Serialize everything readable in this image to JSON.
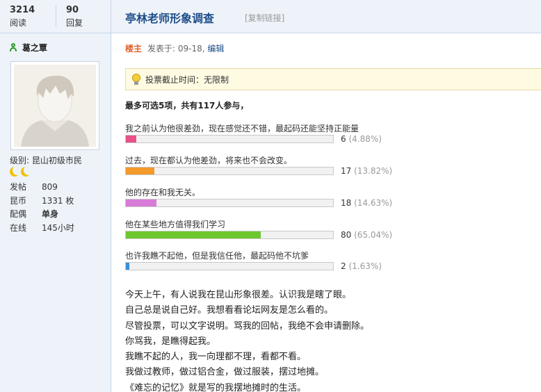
{
  "stats": {
    "reads_value": "3214",
    "reads_label": "阅读",
    "replies_value": "90",
    "replies_label": "回复"
  },
  "thread": {
    "title": "亭林老师形象调查",
    "copy_link": "[复制链接]"
  },
  "user": {
    "name": "葛之覃",
    "level": "级别: 昆山初级市民",
    "profile": [
      {
        "key": "发帖",
        "value": "809",
        "bold": false
      },
      {
        "key": "昆币",
        "value": "1331 枚",
        "bold": false
      },
      {
        "key": "配偶",
        "value": "单身",
        "bold": true
      },
      {
        "key": "在线",
        "value": "145小时",
        "bold": false
      }
    ]
  },
  "post": {
    "owner_label": "楼主",
    "posted": "发表于: 09-18",
    "separator": ",",
    "edit_label": "编辑"
  },
  "poll": {
    "deadline": "投票截止时间：无限制",
    "note": "最多可选5项，共有117人参与，",
    "options": [
      {
        "label": "我之前认为他很差劲，现在感觉还不错，最起码还能坚持正能量",
        "count": "6",
        "pct": "(4.88%)",
        "fraction": 0.0488,
        "color": "#e8508a"
      },
      {
        "label": "过去，现在都认为他差劲，将来也不会改变。",
        "count": "17",
        "pct": "(13.82%)",
        "fraction": 0.1382,
        "color": "#f39a2b"
      },
      {
        "label": "他的存在和我无关。",
        "count": "18",
        "pct": "(14.63%)",
        "fraction": 0.1463,
        "color": "#d87ad8"
      },
      {
        "label": "他在某些地方值得我们学习",
        "count": "80",
        "pct": "(65.04%)",
        "fraction": 0.6504,
        "color": "#6dc72f"
      },
      {
        "label": "也许我瞧不起他，但是我信任他，最起码他不坑爹",
        "count": "2",
        "pct": "(1.63%)",
        "fraction": 0.0163,
        "color": "#3a8fd6"
      }
    ]
  },
  "content": {
    "lines": [
      "今天上午，有人说我在昆山形象很差。认识我是瞎了眼。",
      "自己总是说自己好。我想看看论坛网友是怎么看的。",
      "尽管投票，可以文字说明。骂我的回帖，我绝不会申请删除。",
      "你骂我，是瞧得起我。",
      "我瞧不起的人，我一向理都不理，看都不看。",
      "我做过教师，做过铝合金，做过服装，摆过地摊。",
      "《难忘的记忆》就是写的我摆地摊时的生活。"
    ]
  },
  "icons": {
    "user": "user-icon",
    "bulb": "lightbulb-icon",
    "moon": "moon-rank-icon"
  }
}
